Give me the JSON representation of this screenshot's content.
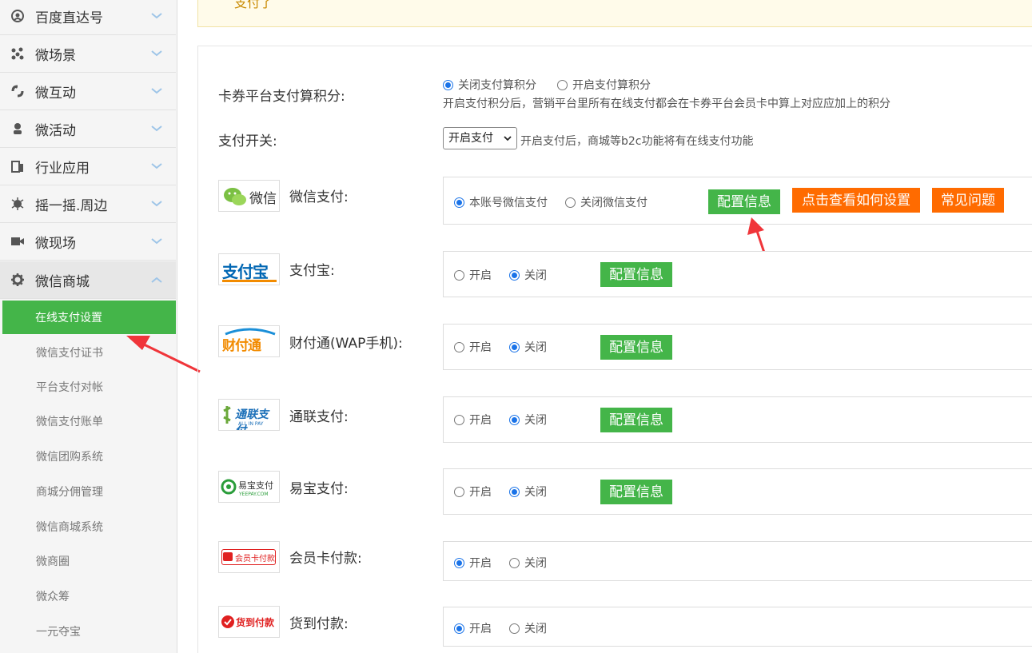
{
  "sidebar": {
    "menu": [
      {
        "label": "百度直达号",
        "icon": "baidu-icon"
      },
      {
        "label": "微场景",
        "icon": "scene-icon"
      },
      {
        "label": "微互动",
        "icon": "interact-icon"
      },
      {
        "label": "微活动",
        "icon": "activity-icon"
      },
      {
        "label": "行业应用",
        "icon": "industry-icon"
      },
      {
        "label": "摇一摇.周边",
        "icon": "shake-icon"
      },
      {
        "label": "微现场",
        "icon": "video-icon"
      },
      {
        "label": "微信商城",
        "icon": "gear-icon"
      }
    ],
    "submenu": [
      {
        "label": "在线支付设置",
        "active": true
      },
      {
        "label": "微信支付证书"
      },
      {
        "label": "平台支付对帐"
      },
      {
        "label": "微信支付账单"
      },
      {
        "label": "微信团购系统"
      },
      {
        "label": "商城分佣管理"
      },
      {
        "label": "微信商城系统"
      },
      {
        "label": "微商圈"
      },
      {
        "label": "微众筹"
      },
      {
        "label": "一元夺宝"
      }
    ]
  },
  "notice": {
    "text": "支付了"
  },
  "points": {
    "label": "卡券平台支付算积分:",
    "option_off": "关闭支付算积分",
    "option_on": "开启支付算积分",
    "selected": "off",
    "hint": "开启支付积分后，营销平台里所有在线支付都会在卡券平台会员卡中算上对应应加上的积分"
  },
  "switch": {
    "label": "支付开关:",
    "selected": "开启支付",
    "hint": "开启支付后，商城等b2c功能将有在线支付功能"
  },
  "methods": {
    "wechat": {
      "logo_text": "微信",
      "label": "微信支付:",
      "opt1": "本账号微信支付",
      "opt2": "关闭微信支付",
      "config": "配置信息",
      "howto": "点击查看如何设置",
      "faq": "常见问题"
    },
    "alipay": {
      "logo_text": "支付宝",
      "label": "支付宝:",
      "on": "开启",
      "off": "关闭",
      "config": "配置信息"
    },
    "tenpay": {
      "logo_text": "财付通",
      "label": "财付通(WAP手机):",
      "on": "开启",
      "off": "关闭",
      "config": "配置信息"
    },
    "allinpay": {
      "logo_text": "通联支付",
      "logo_sub": "ALL IN PAY",
      "label": "通联支付:",
      "on": "开启",
      "off": "关闭",
      "config": "配置信息"
    },
    "yeepay": {
      "logo_text": "易宝支付",
      "logo_sub": "YEEPAY.COM",
      "label": "易宝支付:",
      "on": "开启",
      "off": "关闭",
      "config": "配置信息"
    },
    "membercard": {
      "logo_text": "会员卡付款",
      "label": "会员卡付款:",
      "on": "开启",
      "off": "关闭"
    },
    "cod": {
      "logo_text": "货到付款",
      "label": "货到付款:",
      "on": "开启",
      "off": "关闭"
    }
  },
  "colors": {
    "accent_green": "#44b549",
    "accent_orange": "#ff6b00",
    "annotation_red": "#f0353a"
  }
}
